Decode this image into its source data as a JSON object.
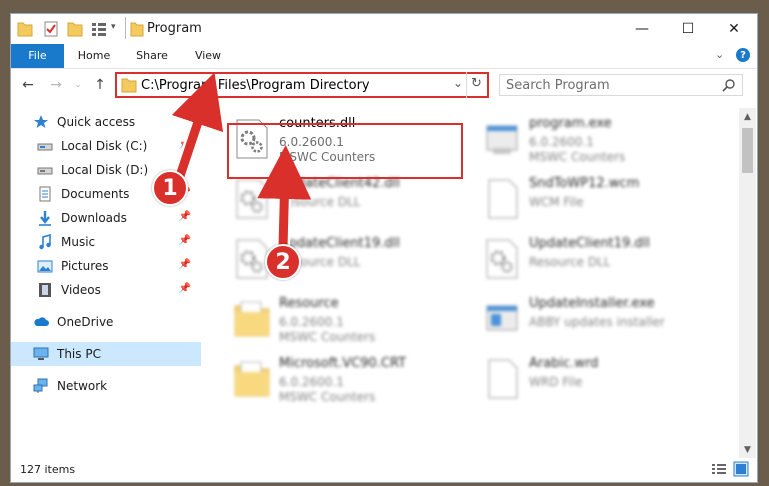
{
  "window": {
    "title": "Program"
  },
  "window_controls": {
    "minimize": "—",
    "maximize": "☐",
    "close": "✕"
  },
  "ribbon": {
    "tabs": [
      "File",
      "Home",
      "Share",
      "View"
    ],
    "help_icon": "?"
  },
  "address": {
    "path": "C:\\Program Files\\Program Directory"
  },
  "search": {
    "placeholder": "Search Program"
  },
  "nav_pane": {
    "items": [
      {
        "label": "Quick access",
        "icon": "star-icon",
        "pinned": false
      },
      {
        "label": "Local Disk (C:)",
        "icon": "drive-icon",
        "pinned": true
      },
      {
        "label": "Local Disk (D:)",
        "icon": "drive-icon",
        "pinned": true
      },
      {
        "label": "Documents",
        "icon": "documents-icon",
        "pinned": true
      },
      {
        "label": "Downloads",
        "icon": "download-arrow-icon",
        "pinned": true
      },
      {
        "label": "Music",
        "icon": "music-note-icon",
        "pinned": true
      },
      {
        "label": "Pictures",
        "icon": "pictures-icon",
        "pinned": true
      },
      {
        "label": "Videos",
        "icon": "video-film-icon",
        "pinned": true
      },
      {
        "label": "OneDrive",
        "icon": "cloud-icon",
        "pinned": false
      },
      {
        "label": "This PC",
        "icon": "monitor-icon",
        "pinned": false
      },
      {
        "label": "Network",
        "icon": "network-icon",
        "pinned": false
      }
    ]
  },
  "files": [
    {
      "name": "counters.dll",
      "line1": "6.0.2600.1",
      "line2": "MSWC Counters",
      "icon": "dll-gear-icon"
    },
    {
      "name": "program.exe",
      "line1": "6.0.2600.1",
      "line2": "MSWC Counters",
      "icon": "exe-icon"
    },
    {
      "name": "UpdateClient42.dll",
      "line1": "Resource DLL",
      "line2": "",
      "icon": "dll-gear-icon"
    },
    {
      "name": "SndToWP12.wcm",
      "line1": "WCM File",
      "line2": "",
      "icon": "blank-file-icon"
    },
    {
      "name": "UpdateClient19.dll",
      "line1": "Resource DLL",
      "line2": "",
      "icon": "dll-gear-icon"
    },
    {
      "name": "UpdateClient19.dll",
      "line1": "Resource DLL",
      "line2": "",
      "icon": "dll-gear-icon"
    },
    {
      "name": "Resource",
      "line1": "6.0.2600.1",
      "line2": "MSWC Counters",
      "icon": "folder-doc-icon"
    },
    {
      "name": "UpdateInstaller.exe",
      "line1": "ABBY updates installer",
      "line2": "",
      "icon": "installer-icon"
    },
    {
      "name": "Microsoft.VC90.CRT",
      "line1": "6.0.2600.1",
      "line2": "MSWC Counters",
      "icon": "folder-doc-icon"
    },
    {
      "name": "Arabic.wrd",
      "line1": "WRD File",
      "line2": "",
      "icon": "blank-file-icon"
    }
  ],
  "status": {
    "items_count": "127 items"
  },
  "annotations": {
    "badge_1": "1",
    "badge_2": "2",
    "accent_color": "#d9302c"
  },
  "colors": {
    "file_tab": "#1979ca",
    "selected_nav": "#cce8ff"
  }
}
